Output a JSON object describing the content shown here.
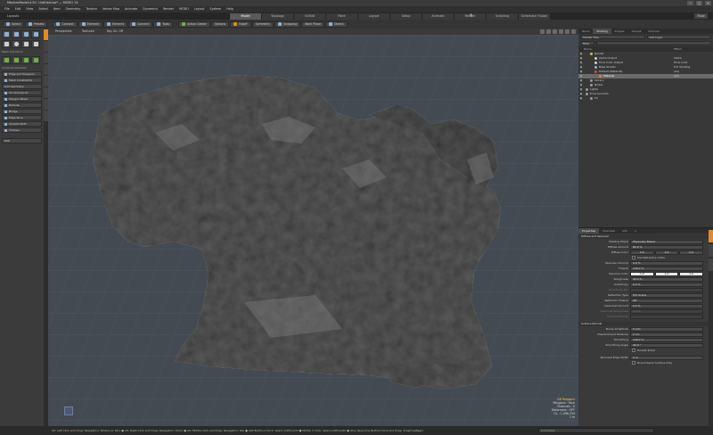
{
  "window": {
    "title": "MeshesModo14.5C: Untitled.lxo* — MODO 14",
    "controls": [
      "–",
      "□",
      "×"
    ]
  },
  "menu": [
    "File",
    "Edit",
    "View",
    "Select",
    "Item",
    "Geometry",
    "Texture",
    "Vertex Map",
    "Animate",
    "Dynamics",
    "Render",
    "MODO",
    "Layout",
    "System",
    "Help"
  ],
  "layout_bar": {
    "label": "Layouts",
    "tabs": [
      "Model",
      "Topology",
      "UVEdit",
      "Paint",
      "Layout",
      "Setup",
      "Animate",
      "Render",
      "Scripting",
      "Schematic Fusion"
    ],
    "active_tab": "Model",
    "right_label": "Mode"
  },
  "toolbar": {
    "items": [
      "Select",
      "Presets",
      "Connect",
      "Element",
      "Element",
      "Connect",
      "Tools",
      "Action Center",
      "Options",
      "Falloff",
      "Symmetry",
      "Snapping",
      "Work Plane",
      "Sketch"
    ]
  },
  "left_panel": {
    "heading_1": "Mesh Transform",
    "heading_2": "Contents Selected",
    "buttons": [
      "Edge and Polygons",
      "Mesh Constraints",
      "Add Geometry",
      "UV Unwrap Lit",
      "Polygon Bevel",
      "Extrude",
      "Bridge",
      "Edge Slice",
      "Smooth Shift",
      "Thicken"
    ],
    "dropdown": "Edit"
  },
  "viewport": {
    "tabs": [
      "Perspective",
      "Textured",
      "Ray GL: Off"
    ],
    "info": [
      "GB Polygons",
      "Polygons : Face",
      "Channels : 0",
      "Deformers : OFF",
      "GL : 1,396,334",
      "1 m"
    ]
  },
  "shader_panel": {
    "tabs": [
      "Items",
      "Shading",
      "Images",
      "Groups",
      "Channel"
    ],
    "active_tab": "Shading",
    "view_select": "Shader Tree",
    "add_layer": "Add Layer",
    "filter_label": "Filter",
    "columns": [
      "Name",
      "Effect"
    ],
    "rows": [
      {
        "name": "Render",
        "effect": "",
        "indent": 1,
        "color": "#e5b24a"
      },
      {
        "name": "Alpha Output",
        "effect": "Alpha",
        "indent": 2,
        "color": "#d0d0d0"
      },
      {
        "name": "Final Color Output",
        "effect": "Final Color",
        "indent": 2,
        "color": "#d0d0d0"
      },
      {
        "name": "Base Shader",
        "effect": "Full Shading",
        "indent": 2,
        "color": "#8fb0d6"
      },
      {
        "name": "Default (Material)",
        "effect": "(all)",
        "indent": 2,
        "color": "#d04a4a"
      },
      {
        "name": "Material",
        "effect": "(all)",
        "indent": 3,
        "color": "#e08a2e"
      },
      {
        "name": "Library",
        "effect": "",
        "indent": 1,
        "color": "#9a9a9a"
      },
      {
        "name": "Nodes",
        "effect": "",
        "indent": 1,
        "color": "#9a9a9a"
      },
      {
        "name": "Lights",
        "effect": "",
        "indent": 0,
        "color": "#9a9a9a"
      },
      {
        "name": "Environments",
        "effect": "",
        "indent": 0,
        "color": "#9a9a9a"
      },
      {
        "name": "FX",
        "effect": "",
        "indent": 1,
        "color": "#9a9a9a"
      }
    ],
    "selected_row": "Material"
  },
  "properties": {
    "tabs": [
      "Properties",
      "Channels",
      "Info",
      "+"
    ],
    "group_1": "Diffuse and Specular",
    "shading_model": {
      "label": "Shading Model",
      "value": "Physically Based"
    },
    "diffuse_amount": {
      "label": "Diffuse Amount",
      "value": "80.0 %"
    },
    "diffuse_color": {
      "label": "Diffuse Color",
      "values": [
        "0.6",
        "0.6",
        "0.6"
      ]
    },
    "use_ref_index": "Use Refractive Index",
    "specular_amount": {
      "label": "Specular Amount",
      "value": "4.0 %"
    },
    "fresnel": {
      "label": "Fresnel",
      "value": "100.0 %"
    },
    "specular_color": {
      "label": "Specular Color",
      "values": [
        "1.0",
        "1.0",
        "1.0"
      ]
    },
    "roughness": {
      "label": "Roughness",
      "value": "40.0 %"
    },
    "anisotropy": {
      "label": "Anisotropy",
      "value": "0.0 %"
    },
    "aniso_dir": {
      "label": "Anisotropy Dir.",
      "value": ""
    },
    "reflection_type": {
      "label": "Reflection Type",
      "value": "Full Scene"
    },
    "reflection_fresnel": {
      "label": "Reflection Fresnel",
      "value": "Off"
    },
    "clearcoat_amount": {
      "label": "Clearcoat Amount",
      "value": "0.0 %"
    },
    "clearcoat_roughness": {
      "label": "Clearcoat Roughness",
      "value": "0.0 %"
    },
    "clearcoat_bump": {
      "label": "Clearcoat Bump",
      "value": ""
    },
    "group_2": "Surface Normal",
    "bump_amplitude": {
      "label": "Bump Amplitude",
      "value": "5 mm"
    },
    "displacement_distance": {
      "label": "Displacement Distance",
      "value": "2 cm"
    },
    "smoothing": {
      "label": "Smoothing",
      "value": "100.0 %"
    },
    "smoothing_angle": {
      "label": "Smoothing Angle",
      "value": "40.0 °"
    },
    "double_sided": "Double Sided",
    "rounded_edge_width": {
      "label": "Rounded Edge Width",
      "value": "0 m"
    },
    "round_same_surface": "Round Same Surface Only"
  },
  "status": {
    "text": "Alt: Left Click and Drag: Navigation: Rotate (or Pan) ● Alt: Right Click and Drag: Navigation: Zoom ● Alt: Middle Click and Drag: Navigation: Pan ● Left Button 2 Click: select_toPDrop3d ● Middle 2 Click: select_toPDrop3d ● [Any Key]-[Any Button] Click and Drag: dragDropBegin",
    "command_placeholder": "Command"
  },
  "colors": {
    "accent": "#e08a2e",
    "viewport_bg": "#444a52",
    "terrain": "#5a5a5a",
    "selection": "#6b6b6b"
  }
}
